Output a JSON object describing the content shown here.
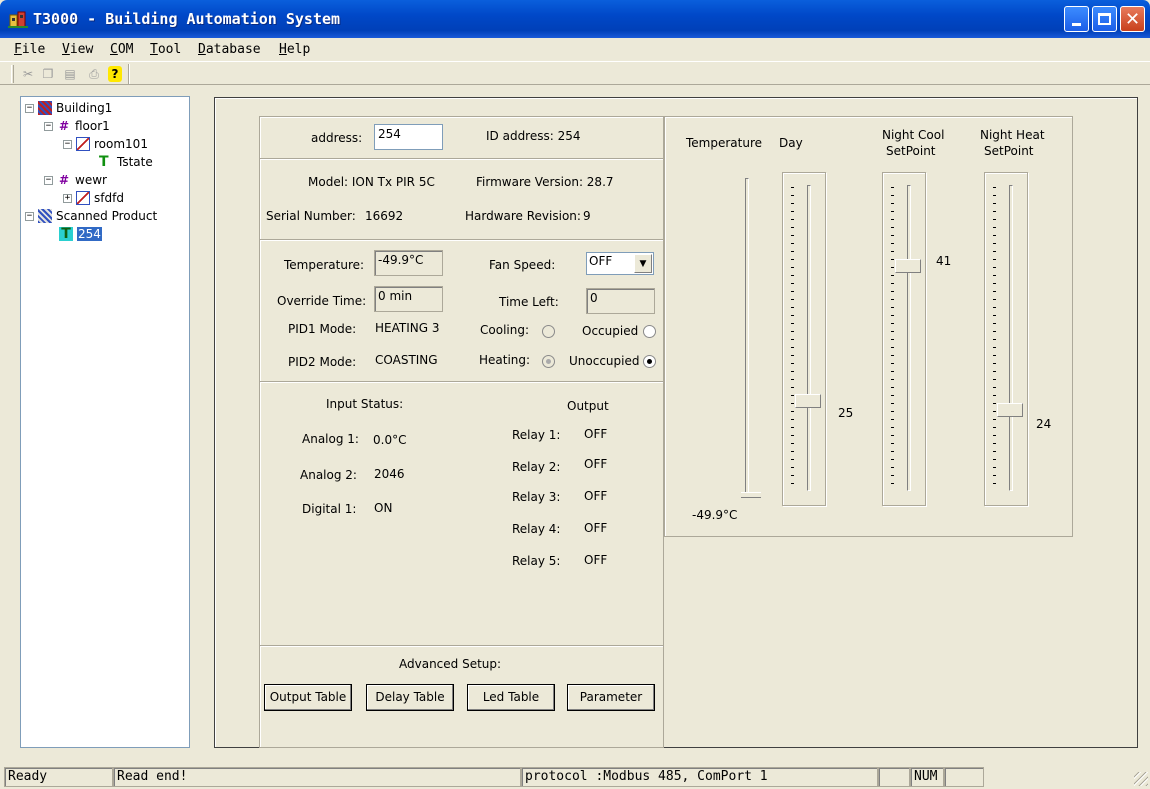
{
  "window": {
    "title": "T3000 - Building Automation System"
  },
  "menu": [
    "File",
    "View",
    "COM",
    "Tool",
    "Database",
    "Help"
  ],
  "menu_underline": [
    "F",
    "V",
    "C",
    "T",
    "D",
    "H"
  ],
  "toolbar": {
    "icons": [
      "cut-icon",
      "copy-icon",
      "paste-icon",
      "print-icon",
      "help-icon"
    ]
  },
  "tree": {
    "building": "Building1",
    "floor1": "floor1",
    "room101": "room101",
    "tstate": "Tstate",
    "wewr": "wewr",
    "sfdfd": "sfdfd",
    "scanned": "Scanned Product",
    "device": "254"
  },
  "device": {
    "address_label": "address:",
    "address_value": "254",
    "id_address": "ID address: 254",
    "model": "Model:  ION Tx PIR 5C",
    "firmware": "Firmware Version:  28.7",
    "serial_label": "Serial Number:",
    "serial_value": "16692",
    "hardware_label": "Hardware Revision:",
    "hardware_value": "9"
  },
  "status": {
    "temperature_label": "Temperature:",
    "temperature_value": "-49.9°C",
    "override_label": "Override Time:",
    "override_value": "0 min",
    "pid1_label": "PID1 Mode:",
    "pid1_value": "HEATING 3",
    "pid2_label": "PID2 Mode:",
    "pid2_value": "COASTING",
    "fan_label": "Fan Speed:",
    "fan_value": "OFF",
    "timeleft_label": "Time Left:",
    "timeleft_value": "0",
    "cooling_label": "Cooling:",
    "heating_label": "Heating:",
    "occupied_label": "Occupied",
    "unoccupied_label": "Unoccupied",
    "heating_checked": true,
    "unoccupied_checked": true
  },
  "inputs": {
    "title": "Input Status:",
    "analog1_label": "Analog 1:",
    "analog1_value": "0.0°C",
    "analog2_label": "Analog 2:",
    "analog2_value": "2046",
    "digital1_label": "Digital 1:",
    "digital1_value": "ON"
  },
  "outputs": {
    "title": "Output",
    "relays": [
      {
        "label": "Relay 1:",
        "value": "OFF"
      },
      {
        "label": "Relay 2:",
        "value": "OFF"
      },
      {
        "label": "Relay 3:",
        "value": "OFF"
      },
      {
        "label": "Relay 4:",
        "value": "OFF"
      },
      {
        "label": "Relay 5:",
        "value": "OFF"
      }
    ]
  },
  "advanced": {
    "title": "Advanced Setup:",
    "output_table": "Output Table",
    "delay_table": "Delay Table",
    "led_table": "Led Table",
    "parameter": "Parameter"
  },
  "sliders": {
    "temperature_label": "Temperature",
    "temperature_value": "-49.9°C",
    "day_label": "Day",
    "day_value": "25",
    "night_cool_label": "Night Cool",
    "night_cool_label2": "SetPoint",
    "night_cool_value": "41",
    "night_heat_label": "Night Heat",
    "night_heat_label2": "SetPoint",
    "night_heat_value": "24"
  },
  "statusbar": {
    "ready": "Ready",
    "message": "Read end!",
    "protocol": "protocol :Modbus 485, ComPort 1",
    "num": "NUM"
  },
  "colors": {
    "titlebar": "#0048c8",
    "selection": "#316ac5",
    "face": "#ece9d8"
  }
}
